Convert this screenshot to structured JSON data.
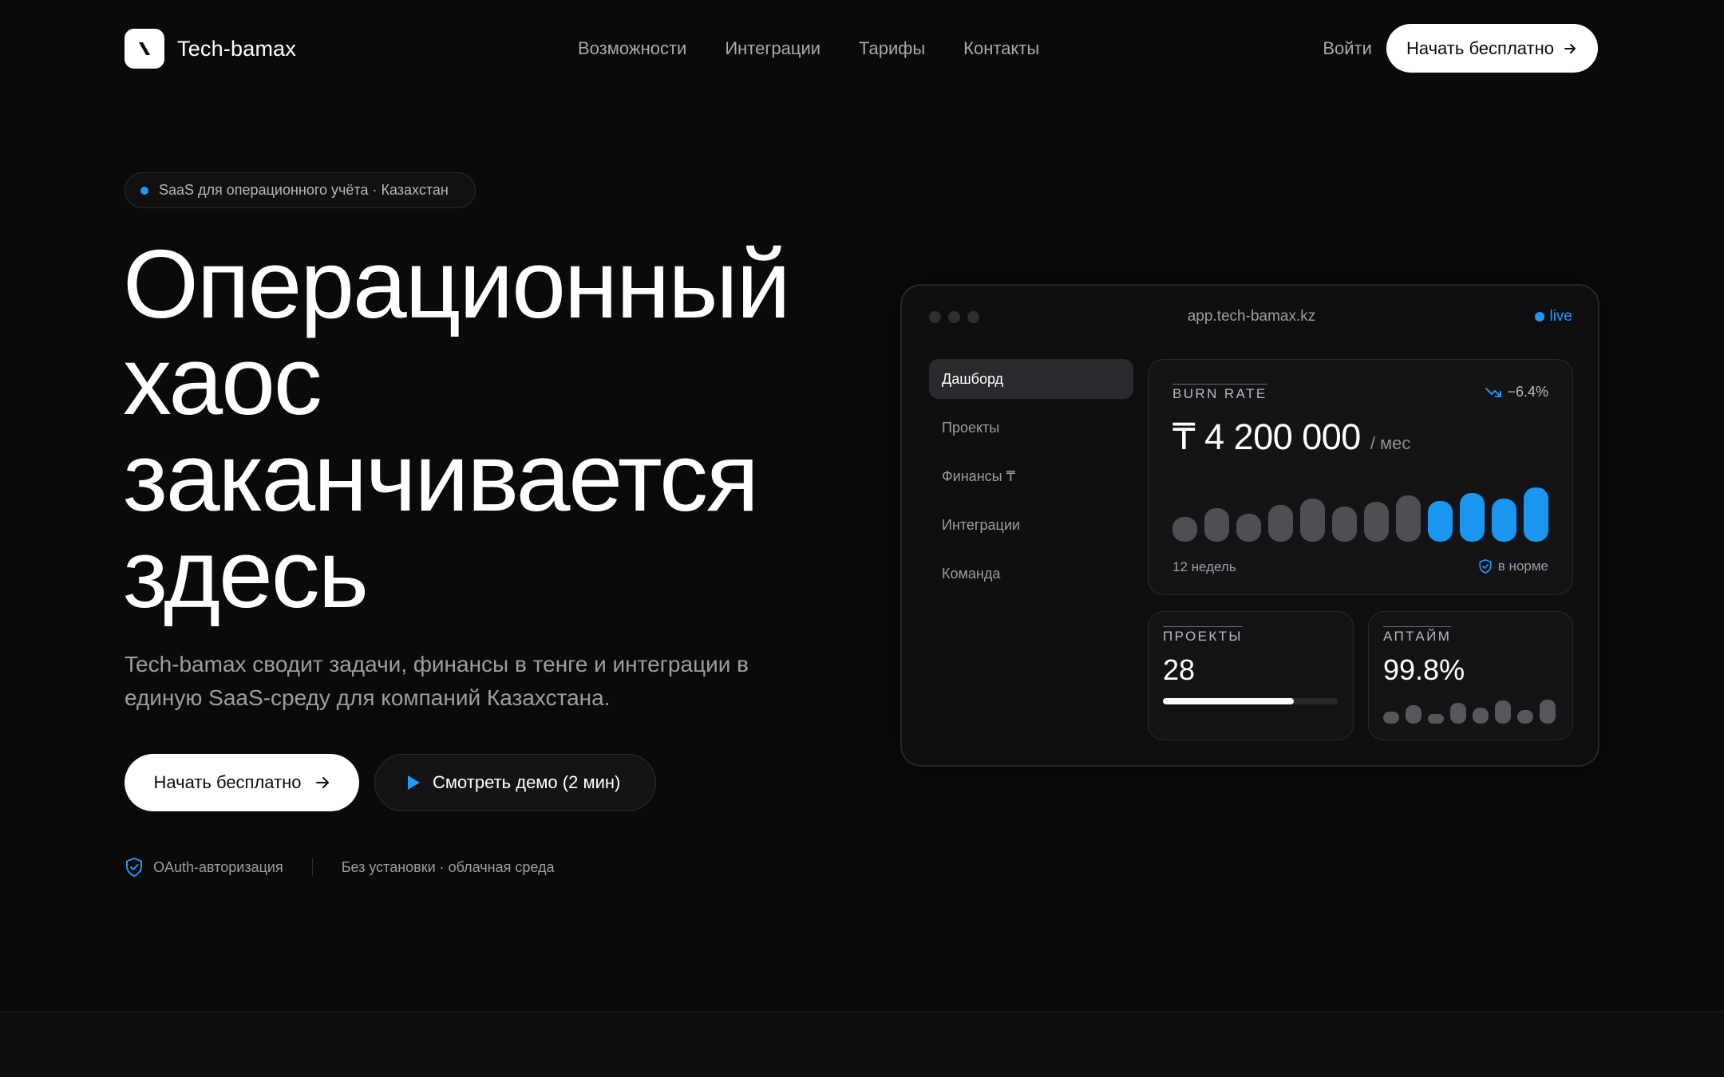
{
  "brand": {
    "name": "Tech-bamax"
  },
  "nav": {
    "links": [
      "Возможности",
      "Интеграции",
      "Тарифы",
      "Контакты"
    ],
    "login": "Войти",
    "cta": "Начать бесплатно"
  },
  "hero": {
    "badge": "SaaS для операционного учёта · Казахстан",
    "title_lines": [
      "Операционный",
      "хаос",
      "заканчивается",
      "здесь"
    ],
    "subtitle": "Tech-bamax сводит задачи, финансы в тенге и интеграции в единую SaaS-среду для компаний Казахстана.",
    "cta_primary": "Начать бесплатно",
    "cta_secondary": "Смотреть демо (2 мин)",
    "trust": [
      "OAuth-авторизация",
      "Без установки · облачная среда"
    ]
  },
  "dashboard": {
    "url": "app.tech-bamax.kz",
    "live": "live",
    "sidebar": [
      "Дашборд",
      "Проекты",
      "Финансы ₸",
      "Интеграции",
      "Команда"
    ],
    "active_item": "Дашборд",
    "burn": {
      "label": "BURN RATE",
      "change": "−6.4%",
      "value": "₸ 4 200 000",
      "unit": "/ мес",
      "period": "12 недель",
      "status": "в норме",
      "bars": [
        0.45,
        0.62,
        0.52,
        0.68,
        0.8,
        0.64,
        0.73,
        0.85,
        0.75,
        0.9,
        0.8,
        1.0
      ],
      "highlight_from": 8,
      "colors": {
        "muted": "#4e4e53",
        "accent": "#1b96ef"
      }
    },
    "projects": {
      "label": "ПРОЕКТЫ",
      "value": "28",
      "progress": 0.75
    },
    "uptime": {
      "label": "АПТАЙМ",
      "value": "99.8%",
      "bars": [
        0.5,
        0.75,
        0.4,
        0.85,
        0.65,
        0.95,
        0.55,
        1.0
      ]
    }
  },
  "colors": {
    "accent": "#2196f3",
    "background": "#0a0a0b"
  }
}
